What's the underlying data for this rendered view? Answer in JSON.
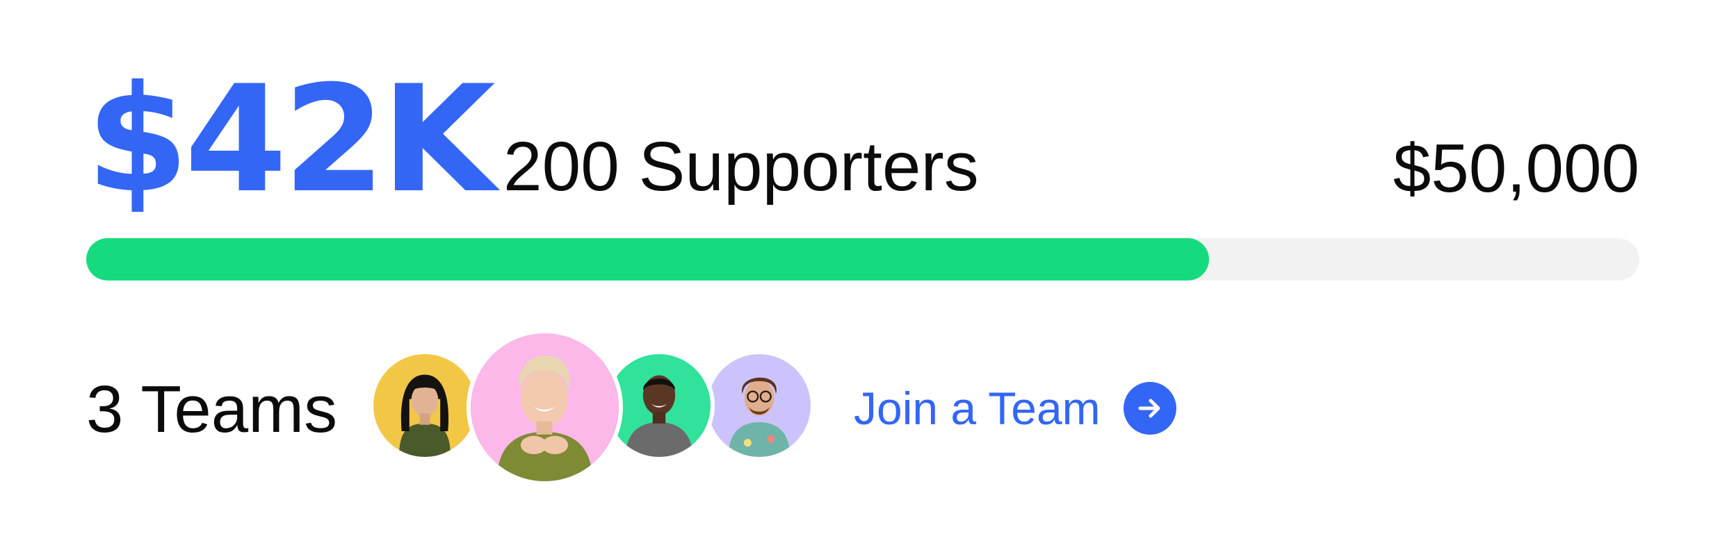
{
  "campaign": {
    "amount_raised_label": "$42K",
    "supporters_label": "200 Supporters",
    "goal_label": "$50,000",
    "progress": {
      "raised": 42000,
      "goal": 50000,
      "fraction": 0.723,
      "fill_color": "#16db7e",
      "track_color": "#f2f2f2"
    }
  },
  "teams": {
    "count_label": "3 Teams",
    "avatars": [
      {
        "name": "avatar",
        "background": "#f2c746"
      },
      {
        "name": "avatar",
        "background": "#fbb8e8"
      },
      {
        "name": "avatar",
        "background": "#31e29a"
      },
      {
        "name": "avatar",
        "background": "#ccc3fc"
      }
    ],
    "join_label": "Join a Team",
    "join_icon": "arrow-right-icon"
  },
  "colors": {
    "accent": "#3366f5",
    "text": "#0b0b0b"
  }
}
